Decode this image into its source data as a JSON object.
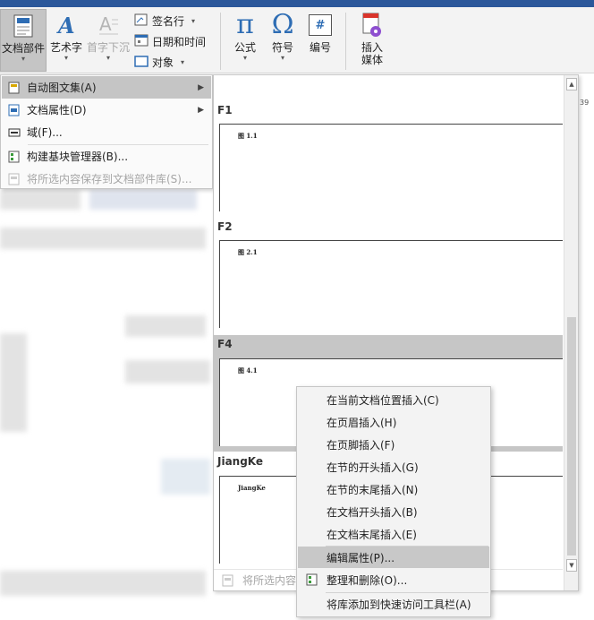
{
  "ribbon": {
    "doc_parts": "文档部件",
    "wordart": "艺术字",
    "dropcap": "首字下沉",
    "signature": "签名行",
    "datetime": "日期和时间",
    "object": "对象",
    "equation": "公式",
    "symbol": "符号",
    "number": "编号",
    "number_icon": "#",
    "media": "插入\n媒体",
    "media_line1": "插入",
    "media_line2": "媒体"
  },
  "dropdown": {
    "items": [
      {
        "label": "自动图文集(A)",
        "icon": "autotext-icon",
        "submenu": true
      },
      {
        "label": "文档属性(D)",
        "icon": "doc-property-icon",
        "submenu": true
      },
      {
        "label": "域(F)...",
        "icon": "field-icon",
        "submenu": false
      },
      {
        "label": "构建基块管理器(B)...",
        "icon": "building-blocks-icon",
        "submenu": false
      },
      {
        "label": "将所选内容保存到文档部件库(S)...",
        "icon": "save-selection-icon",
        "submenu": false,
        "disabled": true
      }
    ]
  },
  "gallery": {
    "entries": [
      {
        "name": "F1",
        "caption": "图 1.1"
      },
      {
        "name": "F2",
        "caption": "图 2.1"
      },
      {
        "name": "F4",
        "caption": "图 4.1",
        "selected": true
      },
      {
        "name": "JiangKe",
        "caption": "JiangKe"
      }
    ],
    "footer": "将所选内容",
    "partial_number": "39"
  },
  "context_menu": {
    "items": [
      {
        "label": "在当前文档位置插入(C)"
      },
      {
        "label": "在页眉插入(H)"
      },
      {
        "label": "在页脚插入(F)"
      },
      {
        "label": "在节的开头插入(G)"
      },
      {
        "label": "在节的末尾插入(N)"
      },
      {
        "label": "在文档开头插入(B)"
      },
      {
        "label": "在文档末尾插入(E)"
      },
      {
        "label": "编辑属性(P)...",
        "highlighted": true
      },
      {
        "label": "整理和删除(O)...",
        "icon": "organize-icon"
      },
      {
        "label": "将库添加到快速访问工具栏(A)"
      }
    ]
  },
  "colors": {
    "accent": "#2b579a",
    "highlight": "#c5c5c5",
    "equation_blue": "#2e6db4"
  }
}
